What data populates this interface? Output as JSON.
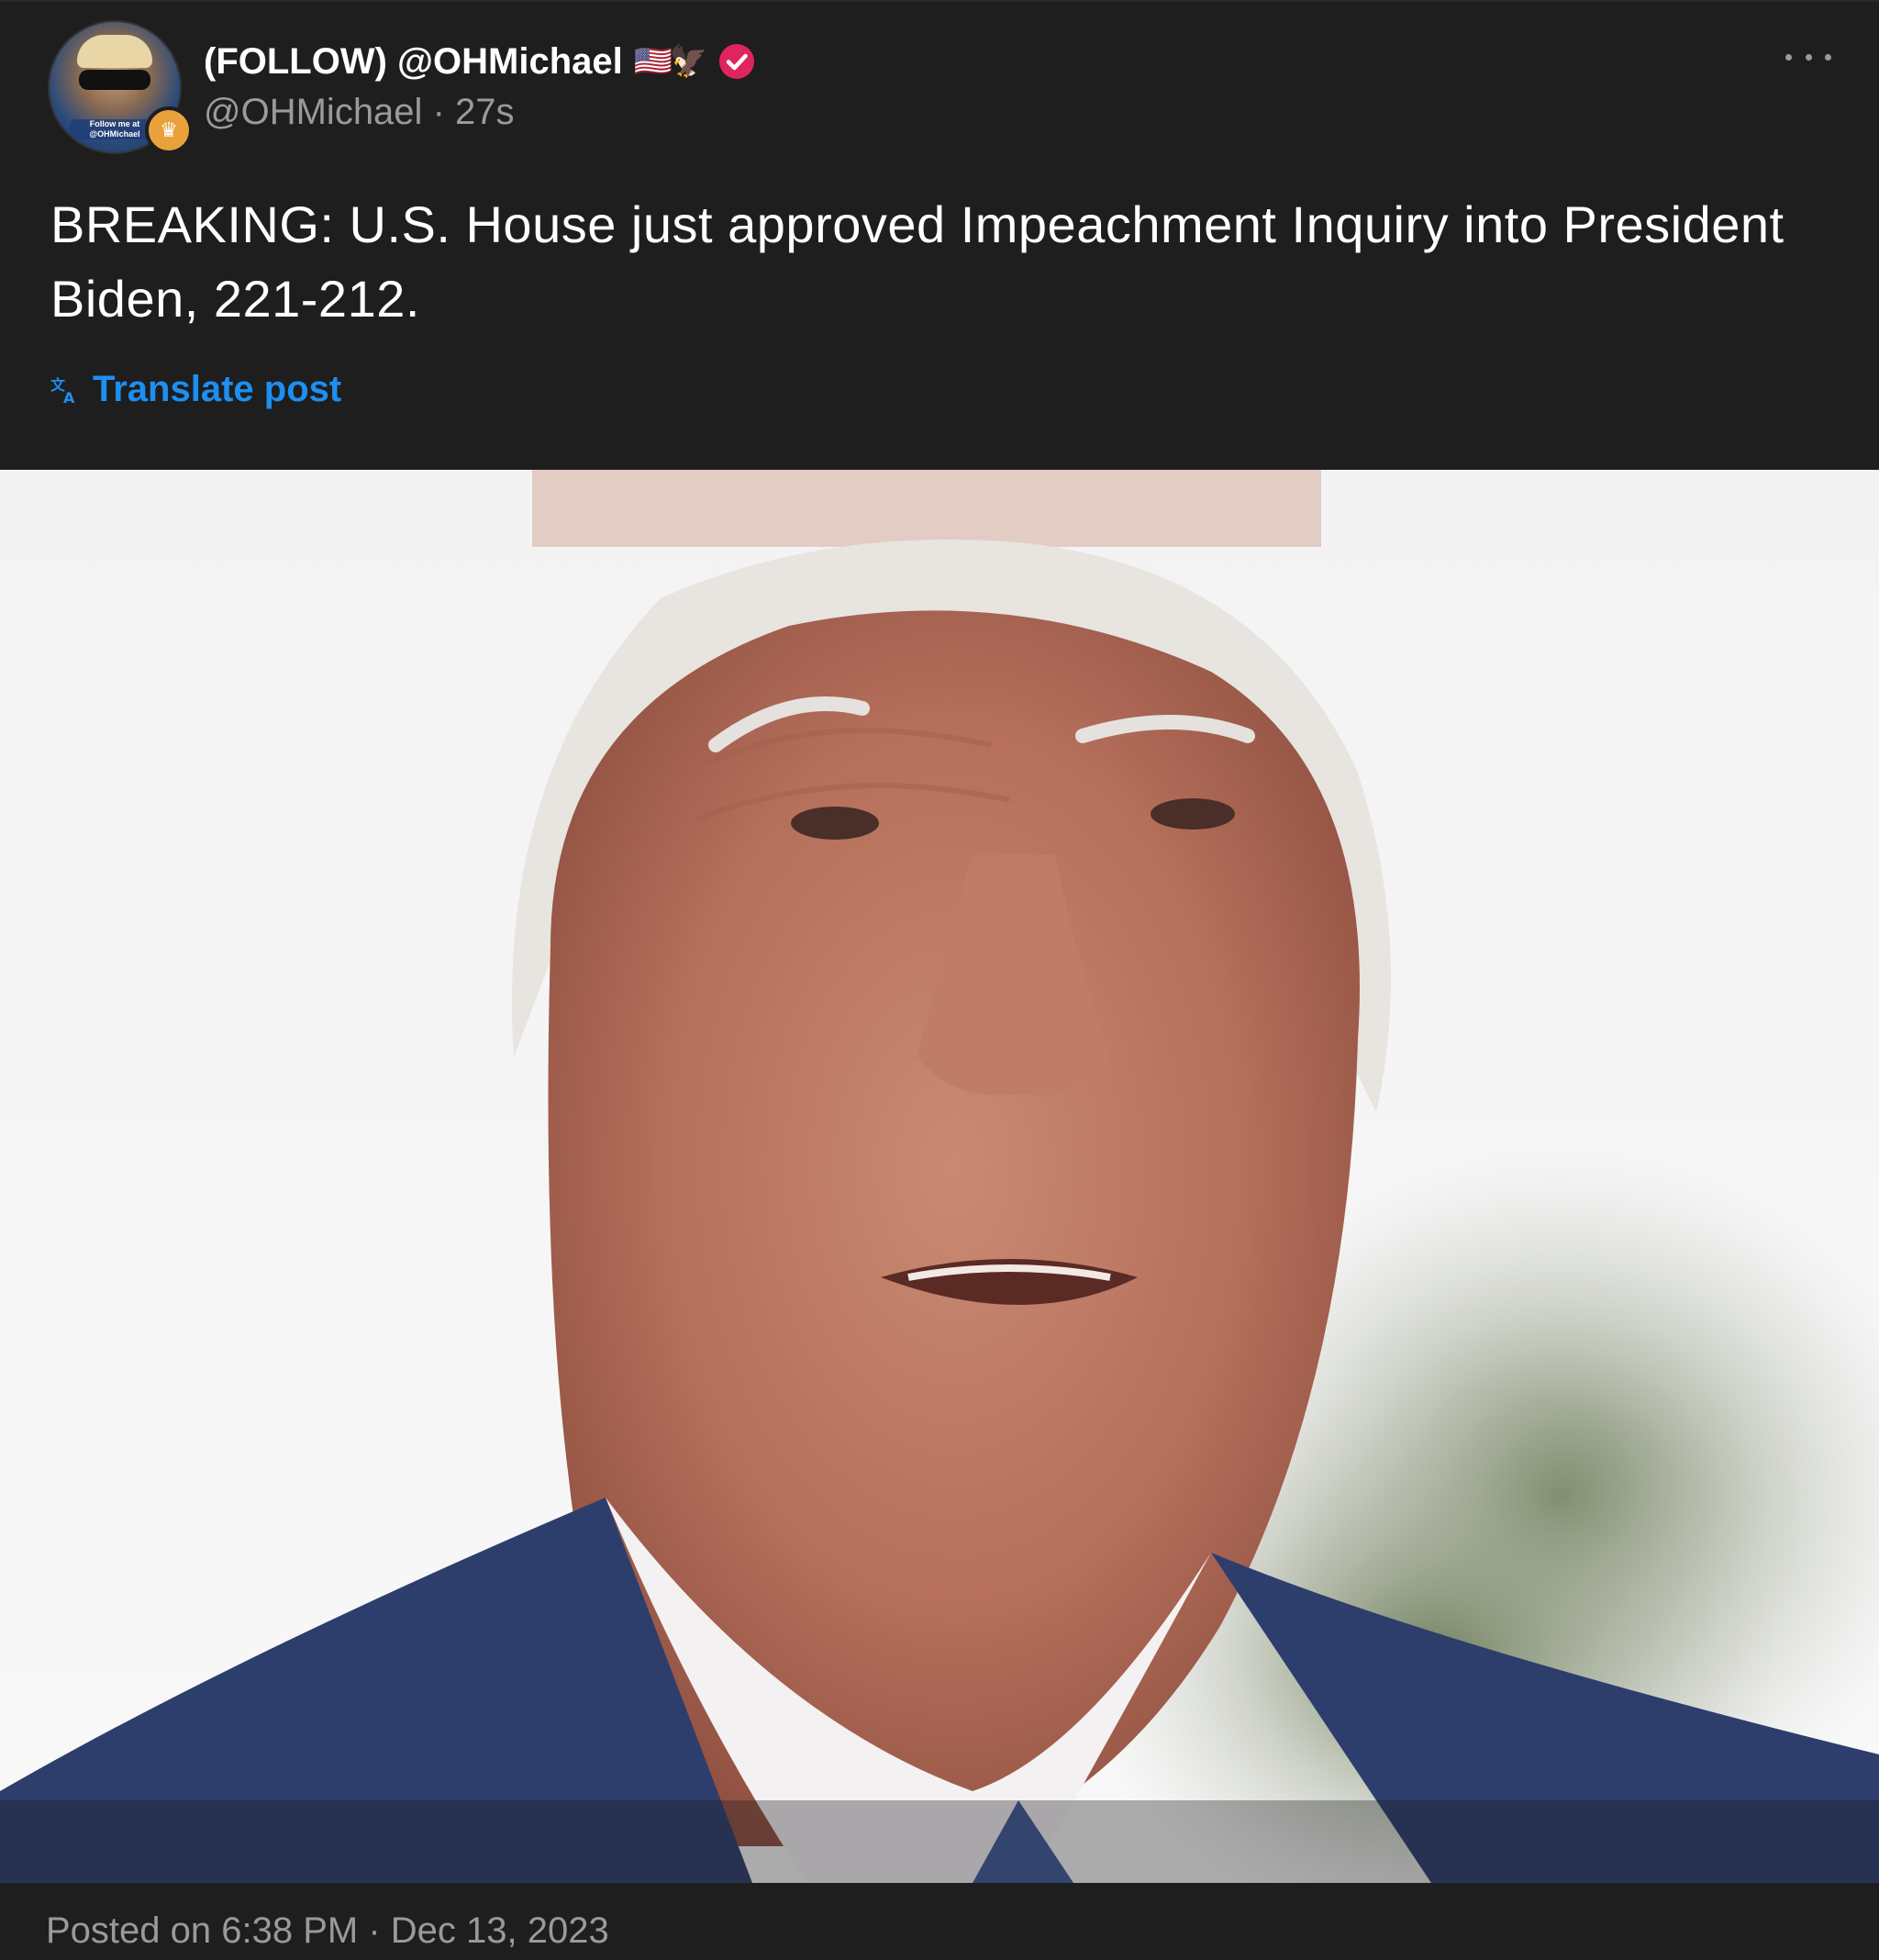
{
  "post": {
    "display_name": "(FOLLOW) @OHMichael",
    "name_emoji": "🇺🇸🦅",
    "handle": "@OHMichael",
    "age": "27s",
    "separator": "·",
    "text": "BREAKING: U.S. House just approved Impeachment Inquiry into President Biden, 221-212.",
    "translate_label": "Translate post",
    "avatar_caption": "Follow me at @OHMichael",
    "posted_label": "Posted on 6:38 PM · Dec 13, 2023"
  },
  "colors": {
    "background": "#1e1e1f",
    "verified": "#e0245e",
    "link": "#1d8ff0",
    "muted": "#9a9a9e"
  },
  "icons": {
    "verified": "verified-badge-icon",
    "more": "more-dots-icon",
    "translate": "translate-icon",
    "avatar_badge": "crown-badge-icon"
  }
}
